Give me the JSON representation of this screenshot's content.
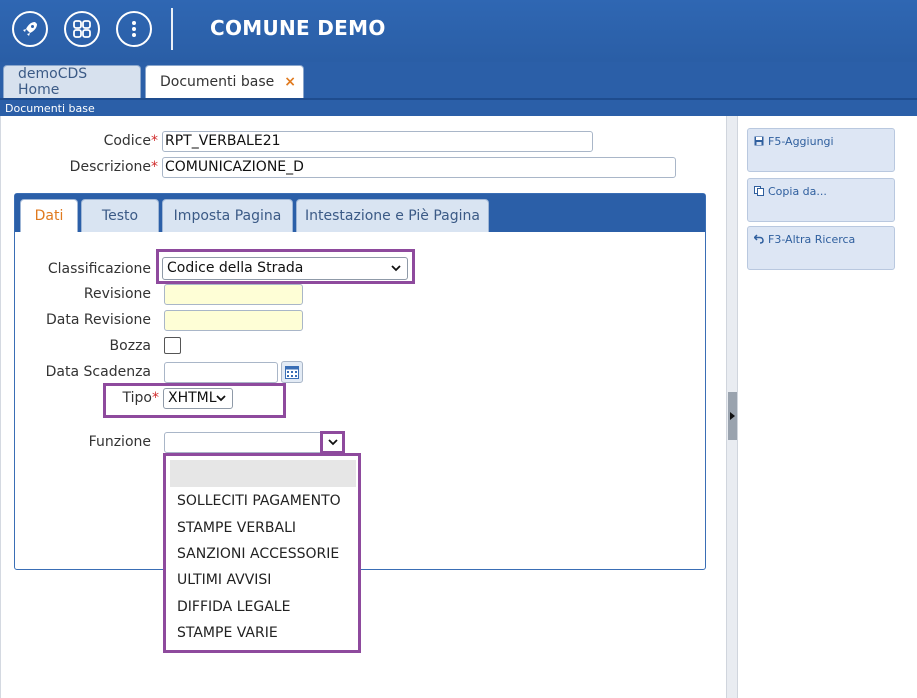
{
  "header": {
    "title": "COMUNE DEMO",
    "icons": [
      "rocket-icon",
      "apps-grid-icon",
      "more-vertical-icon"
    ]
  },
  "tabs": [
    {
      "label": "demoCDS Home",
      "active": false
    },
    {
      "label": "Documenti base",
      "active": true,
      "close": "×"
    }
  ],
  "breadcrumb": "Documenti base",
  "form": {
    "codice_label": "Codice",
    "codice_value": "RPT_VERBALE21",
    "descrizione_label": "Descrizione",
    "descrizione_value": "COMUNICAZIONE_D",
    "required_mark": "*"
  },
  "inner_tabs": [
    {
      "label": "Dati",
      "active": true
    },
    {
      "label": "Testo",
      "active": false
    },
    {
      "label": "Imposta Pagina",
      "active": false
    },
    {
      "label": "Intestazione e Piè Pagina",
      "active": false
    }
  ],
  "dati": {
    "classificazione_label": "Classificazione",
    "classificazione_value": "Codice della Strada",
    "revisione_label": "Revisione",
    "revisione_value": "",
    "data_revisione_label": "Data Revisione",
    "data_revisione_value": "",
    "bozza_label": "Bozza",
    "bozza_checked": false,
    "data_scadenza_label": "Data Scadenza",
    "data_scadenza_value": "",
    "tipo_label": "Tipo",
    "tipo_value": "XHTML",
    "funzione_label": "Funzione",
    "funzione_value": ""
  },
  "funzione_options": [
    "",
    "SOLLECITI PAGAMENTO",
    "STAMPE VERBALI",
    "SANZIONI ACCESSORIE",
    "ULTIMI AVVISI",
    "DIFFIDA LEGALE",
    "STAMPE VARIE"
  ],
  "actions": [
    {
      "label": "F5-Aggiungi",
      "icon": "save-icon"
    },
    {
      "label": "Copia da...",
      "icon": "copy-icon"
    },
    {
      "label": "F3-Altra Ricerca",
      "icon": "undo-icon"
    }
  ],
  "colors": {
    "header_blue": "#2b5fa8",
    "active_tab_orange": "#e07a1f",
    "highlight_purple": "#8e4a9d",
    "required_red": "#d02b2b",
    "readonly_yellow": "#fefed6"
  }
}
